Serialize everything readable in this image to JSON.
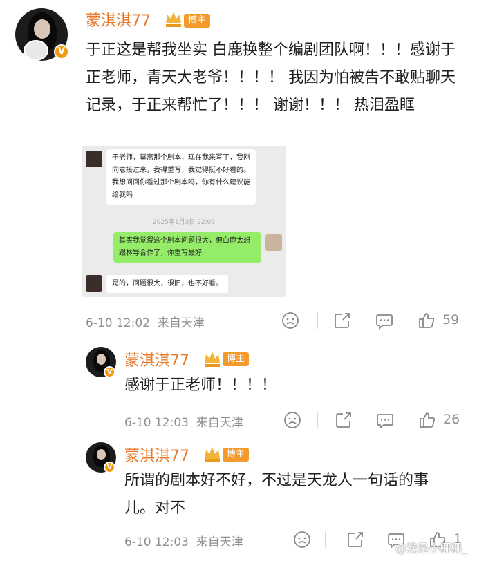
{
  "comments": [
    {
      "username": "蒙淇淇77",
      "role_badge": "博主",
      "text": "于正这是帮我坐实 白鹿换整个编剧团队啊！！！感谢于正老师，青天大老爷！！！！ 我因为怕被告不敢贴聊天记录，于正来帮忙了！！！ 谢谢！！！ 热泪盈眶",
      "time": "6-10 12:02",
      "source": "来自天津",
      "likes": "59"
    },
    {
      "username": "蒙淇淇77",
      "role_badge": "博主",
      "text": "感谢于正老师！！！！",
      "time": "6-10 12:03",
      "source": "来自天津",
      "likes": "26"
    },
    {
      "username": "蒙淇淇77",
      "role_badge": "博主",
      "text": "所谓的剧本好不好，不过是天龙人一句话的事儿。对不",
      "time": "6-10 12:03",
      "source": "来自天津",
      "likes": "1"
    }
  ],
  "chat": {
    "msg1": "于老师，莫离那个剧本，现在我来写了，我刚同意接过来，我得重写，我觉得挺不好看的。我想问问你看过那个剧本吗，你有什么建议能给我吗",
    "timestamp": "2025年1月3日 22:03",
    "msg2": "其实我觉得这个剧本问题很大，但白鹿太想跟林导合作了，你重写最好",
    "msg3": "是的，问题很大，很旧，也不好看。"
  },
  "watermark": "@我是小椰椰_",
  "colors": {
    "username": "#e8792a",
    "badge": "#f39a2b",
    "chat_green": "#95ec69"
  },
  "icons": [
    "dislike-icon",
    "share-icon",
    "comment-icon",
    "like-icon",
    "crown-icon",
    "verified-v-icon"
  ]
}
